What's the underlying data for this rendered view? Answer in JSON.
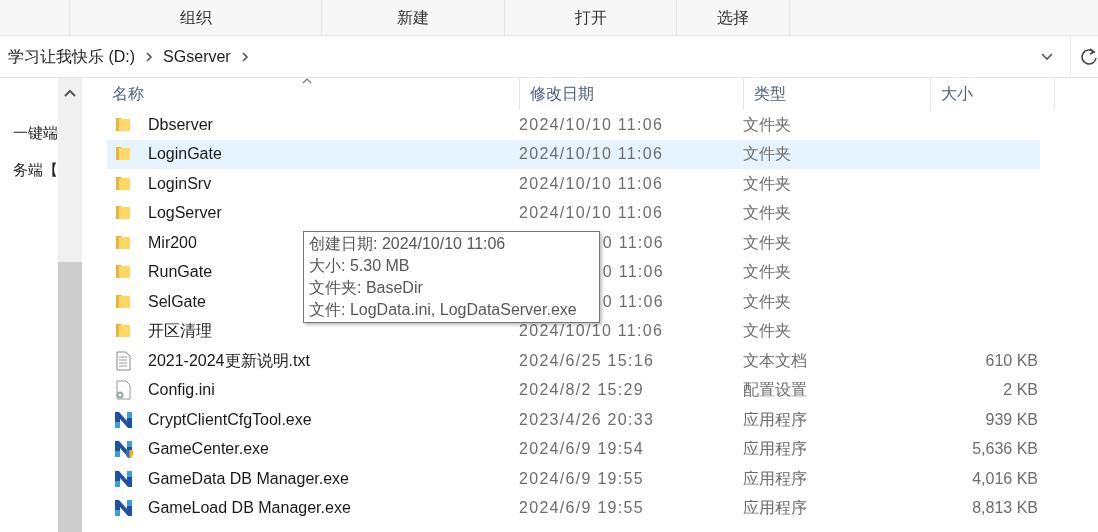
{
  "toolbar": {
    "buttons": [
      "组织",
      "新建",
      "打开",
      "选择"
    ]
  },
  "address_bar": {
    "path": [
      "学习让我快乐 (D:)",
      "SGserver"
    ]
  },
  "navigation_pane": {
    "items": [
      "一键端",
      "务端【"
    ]
  },
  "columns": [
    "名称",
    "修改日期",
    "类型",
    "大小"
  ],
  "rows": [
    {
      "kind": "folder",
      "name": "Dbserver",
      "modified": "2024/10/10 11:06",
      "type": "文件夹",
      "selected": false
    },
    {
      "kind": "folder",
      "name": "LoginGate",
      "modified": "2024/10/10 11:06",
      "type": "文件夹",
      "selected": true
    },
    {
      "kind": "folder",
      "name": "LoginSrv",
      "modified": "2024/10/10 11:06",
      "type": "文件夹",
      "selected": false
    },
    {
      "kind": "folder",
      "name": "LogServer",
      "modified": "2024/10/10 11:06",
      "type": "文件夹",
      "selected": false
    },
    {
      "kind": "folder",
      "name": "Mir200",
      "modified": "0 11:06",
      "modified_covered": true,
      "type": "文件夹",
      "selected": false
    },
    {
      "kind": "folder",
      "name": "RunGate",
      "modified": "0 11:06",
      "modified_covered": true,
      "type": "文件夹",
      "selected": false
    },
    {
      "kind": "folder",
      "name": "SelGate",
      "modified": "0 11:06",
      "modified_covered": true,
      "type": "文件夹",
      "selected": false
    },
    {
      "kind": "folder",
      "name": "开区清理",
      "modified": "2024/10/10 11:06",
      "type": "文件夹",
      "selected": false
    },
    {
      "kind": "text",
      "name": "2021-2024更新说明.txt",
      "modified": "2024/6/25 15:16",
      "type": "文本文档",
      "size": "610 KB",
      "selected": false
    },
    {
      "kind": "config",
      "name": "Config.ini",
      "modified": "2024/8/2 15:29",
      "type": "配置设置",
      "size": "2 KB",
      "selected": false
    },
    {
      "kind": "app",
      "name": "CryptClientCfgTool.exe",
      "modified": "2023/4/26 20:33",
      "type": "应用程序",
      "size": "939 KB",
      "selected": false
    },
    {
      "kind": "app_shield",
      "name": "GameCenter.exe",
      "modified": "2024/6/9 19:54",
      "type": "应用程序",
      "size": "5,636 KB",
      "selected": false
    },
    {
      "kind": "app",
      "name": "GameData DB Manager.exe",
      "modified": "2024/6/9 19:55",
      "type": "应用程序",
      "size": "4,016 KB",
      "selected": false
    },
    {
      "kind": "app",
      "name": "GameLoad DB Manager.exe",
      "modified": "2024/6/9 19:55",
      "type": "应用程序",
      "size": "8,813 KB",
      "selected": false
    }
  ],
  "tooltip": {
    "lines": [
      "创建日期: 2024/10/10 11:06",
      "大小: 5.30 MB",
      "文件夹: BaseDir",
      "文件: LogData.ini, LogDataServer.exe"
    ]
  }
}
